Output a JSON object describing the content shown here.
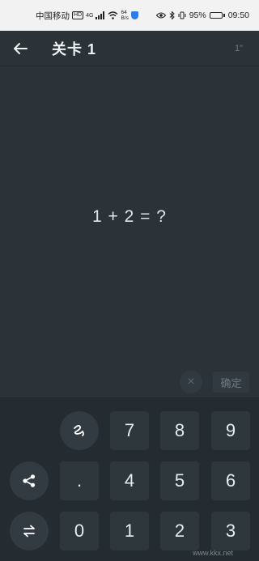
{
  "status_bar": {
    "carrier": "中国移动",
    "hd": "HD",
    "network": "4G",
    "speed_value": "64",
    "speed_unit": "B/s",
    "battery": "95%",
    "time": "09:50"
  },
  "header": {
    "title": "关卡 1",
    "timer": "1\""
  },
  "question": "1 + 2 = ?",
  "answer_row": {
    "clear_label": "×",
    "confirm_label": "确定"
  },
  "keypad": {
    "row1": [
      "7",
      "8",
      "9"
    ],
    "row2": [
      ".",
      "4",
      "5",
      "6"
    ],
    "row3": [
      "0",
      "1",
      "2",
      "3"
    ]
  },
  "watermark": "www.kkx.net"
}
